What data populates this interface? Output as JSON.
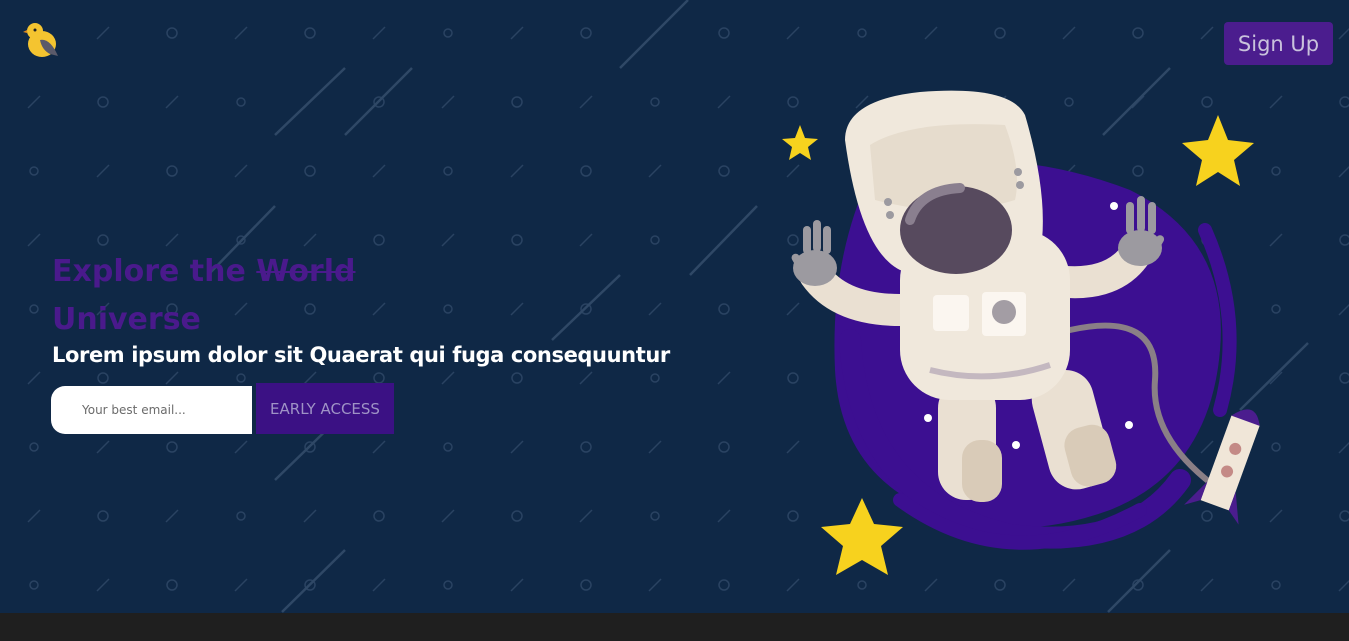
{
  "header": {
    "logo_icon": "bird-logo-icon",
    "signup_label": "Sign Up"
  },
  "hero": {
    "headline_prefix": "Explore the ",
    "headline_struck": "World",
    "headline_line2": "Universe",
    "subtitle": "Lorem ipsum dolor sit Quaerat qui fuga consequuntur",
    "email_placeholder": "Your best email...",
    "cta_label": "EARLY ACCESS",
    "illustration_icon": "astronaut-illustration"
  },
  "colors": {
    "background": "#0f2846",
    "accent": "#4b1d8e",
    "headline": "#4a1a8c",
    "footer": "#1f1f1f"
  }
}
